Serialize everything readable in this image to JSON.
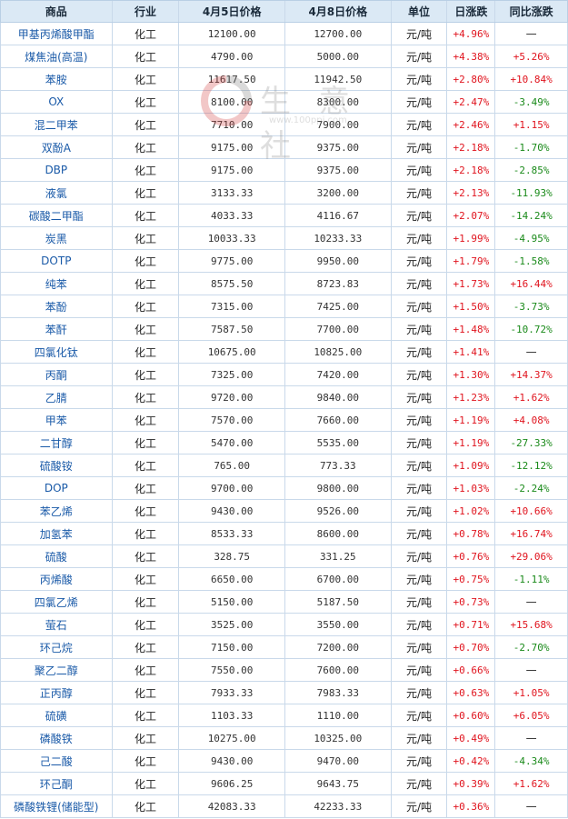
{
  "columns": [
    "商品",
    "行业",
    "4月5日价格",
    "4月8日价格",
    "单位",
    "日涨跌",
    "同比涨跌"
  ],
  "watermark": {
    "text": "生 意 社",
    "sub": "www.100ppi.com"
  },
  "rows": [
    {
      "product": "甲基丙烯酸甲酯",
      "industry": "化工",
      "price1": "12100.00",
      "price2": "12700.00",
      "unit": "元/吨",
      "daily": "+4.96%",
      "yoy": "—"
    },
    {
      "product": "煤焦油(高温)",
      "industry": "化工",
      "price1": "4790.00",
      "price2": "5000.00",
      "unit": "元/吨",
      "daily": "+4.38%",
      "yoy": "+5.26%"
    },
    {
      "product": "苯胺",
      "industry": "化工",
      "price1": "11617.50",
      "price2": "11942.50",
      "unit": "元/吨",
      "daily": "+2.80%",
      "yoy": "+10.84%"
    },
    {
      "product": "OX",
      "industry": "化工",
      "price1": "8100.00",
      "price2": "8300.00",
      "unit": "元/吨",
      "daily": "+2.47%",
      "yoy": "-3.49%"
    },
    {
      "product": "混二甲苯",
      "industry": "化工",
      "price1": "7710.00",
      "price2": "7900.00",
      "unit": "元/吨",
      "daily": "+2.46%",
      "yoy": "+1.15%"
    },
    {
      "product": "双酚A",
      "industry": "化工",
      "price1": "9175.00",
      "price2": "9375.00",
      "unit": "元/吨",
      "daily": "+2.18%",
      "yoy": "-1.70%"
    },
    {
      "product": "DBP",
      "industry": "化工",
      "price1": "9175.00",
      "price2": "9375.00",
      "unit": "元/吨",
      "daily": "+2.18%",
      "yoy": "-2.85%"
    },
    {
      "product": "液氯",
      "industry": "化工",
      "price1": "3133.33",
      "price2": "3200.00",
      "unit": "元/吨",
      "daily": "+2.13%",
      "yoy": "-11.93%"
    },
    {
      "product": "碳酸二甲酯",
      "industry": "化工",
      "price1": "4033.33",
      "price2": "4116.67",
      "unit": "元/吨",
      "daily": "+2.07%",
      "yoy": "-14.24%"
    },
    {
      "product": "炭黑",
      "industry": "化工",
      "price1": "10033.33",
      "price2": "10233.33",
      "unit": "元/吨",
      "daily": "+1.99%",
      "yoy": "-4.95%"
    },
    {
      "product": "DOTP",
      "industry": "化工",
      "price1": "9775.00",
      "price2": "9950.00",
      "unit": "元/吨",
      "daily": "+1.79%",
      "yoy": "-1.58%"
    },
    {
      "product": "纯苯",
      "industry": "化工",
      "price1": "8575.50",
      "price2": "8723.83",
      "unit": "元/吨",
      "daily": "+1.73%",
      "yoy": "+16.44%"
    },
    {
      "product": "苯酚",
      "industry": "化工",
      "price1": "7315.00",
      "price2": "7425.00",
      "unit": "元/吨",
      "daily": "+1.50%",
      "yoy": "-3.73%"
    },
    {
      "product": "苯酐",
      "industry": "化工",
      "price1": "7587.50",
      "price2": "7700.00",
      "unit": "元/吨",
      "daily": "+1.48%",
      "yoy": "-10.72%"
    },
    {
      "product": "四氯化钛",
      "industry": "化工",
      "price1": "10675.00",
      "price2": "10825.00",
      "unit": "元/吨",
      "daily": "+1.41%",
      "yoy": "—"
    },
    {
      "product": "丙酮",
      "industry": "化工",
      "price1": "7325.00",
      "price2": "7420.00",
      "unit": "元/吨",
      "daily": "+1.30%",
      "yoy": "+14.37%"
    },
    {
      "product": "乙腈",
      "industry": "化工",
      "price1": "9720.00",
      "price2": "9840.00",
      "unit": "元/吨",
      "daily": "+1.23%",
      "yoy": "+1.62%"
    },
    {
      "product": "甲苯",
      "industry": "化工",
      "price1": "7570.00",
      "price2": "7660.00",
      "unit": "元/吨",
      "daily": "+1.19%",
      "yoy": "+4.08%"
    },
    {
      "product": "二甘醇",
      "industry": "化工",
      "price1": "5470.00",
      "price2": "5535.00",
      "unit": "元/吨",
      "daily": "+1.19%",
      "yoy": "-27.33%"
    },
    {
      "product": "硫酸铵",
      "industry": "化工",
      "price1": "765.00",
      "price2": "773.33",
      "unit": "元/吨",
      "daily": "+1.09%",
      "yoy": "-12.12%"
    },
    {
      "product": "DOP",
      "industry": "化工",
      "price1": "9700.00",
      "price2": "9800.00",
      "unit": "元/吨",
      "daily": "+1.03%",
      "yoy": "-2.24%"
    },
    {
      "product": "苯乙烯",
      "industry": "化工",
      "price1": "9430.00",
      "price2": "9526.00",
      "unit": "元/吨",
      "daily": "+1.02%",
      "yoy": "+10.66%"
    },
    {
      "product": "加氢苯",
      "industry": "化工",
      "price1": "8533.33",
      "price2": "8600.00",
      "unit": "元/吨",
      "daily": "+0.78%",
      "yoy": "+16.74%"
    },
    {
      "product": "硫酸",
      "industry": "化工",
      "price1": "328.75",
      "price2": "331.25",
      "unit": "元/吨",
      "daily": "+0.76%",
      "yoy": "+29.06%"
    },
    {
      "product": "丙烯酸",
      "industry": "化工",
      "price1": "6650.00",
      "price2": "6700.00",
      "unit": "元/吨",
      "daily": "+0.75%",
      "yoy": "-1.11%"
    },
    {
      "product": "四氯乙烯",
      "industry": "化工",
      "price1": "5150.00",
      "price2": "5187.50",
      "unit": "元/吨",
      "daily": "+0.73%",
      "yoy": "—"
    },
    {
      "product": "萤石",
      "industry": "化工",
      "price1": "3525.00",
      "price2": "3550.00",
      "unit": "元/吨",
      "daily": "+0.71%",
      "yoy": "+15.68%"
    },
    {
      "product": "环己烷",
      "industry": "化工",
      "price1": "7150.00",
      "price2": "7200.00",
      "unit": "元/吨",
      "daily": "+0.70%",
      "yoy": "-2.70%"
    },
    {
      "product": "聚乙二醇",
      "industry": "化工",
      "price1": "7550.00",
      "price2": "7600.00",
      "unit": "元/吨",
      "daily": "+0.66%",
      "yoy": "—"
    },
    {
      "product": "正丙醇",
      "industry": "化工",
      "price1": "7933.33",
      "price2": "7983.33",
      "unit": "元/吨",
      "daily": "+0.63%",
      "yoy": "+1.05%"
    },
    {
      "product": "硫磺",
      "industry": "化工",
      "price1": "1103.33",
      "price2": "1110.00",
      "unit": "元/吨",
      "daily": "+0.60%",
      "yoy": "+6.05%"
    },
    {
      "product": "磷酸铁",
      "industry": "化工",
      "price1": "10275.00",
      "price2": "10325.00",
      "unit": "元/吨",
      "daily": "+0.49%",
      "yoy": "—"
    },
    {
      "product": "己二酸",
      "industry": "化工",
      "price1": "9430.00",
      "price2": "9470.00",
      "unit": "元/吨",
      "daily": "+0.42%",
      "yoy": "-4.34%"
    },
    {
      "product": "环己酮",
      "industry": "化工",
      "price1": "9606.25",
      "price2": "9643.75",
      "unit": "元/吨",
      "daily": "+0.39%",
      "yoy": "+1.62%"
    },
    {
      "product": "磷酸铁锂(储能型)",
      "industry": "化工",
      "price1": "42083.33",
      "price2": "42233.33",
      "unit": "元/吨",
      "daily": "+0.36%",
      "yoy": "—"
    }
  ]
}
